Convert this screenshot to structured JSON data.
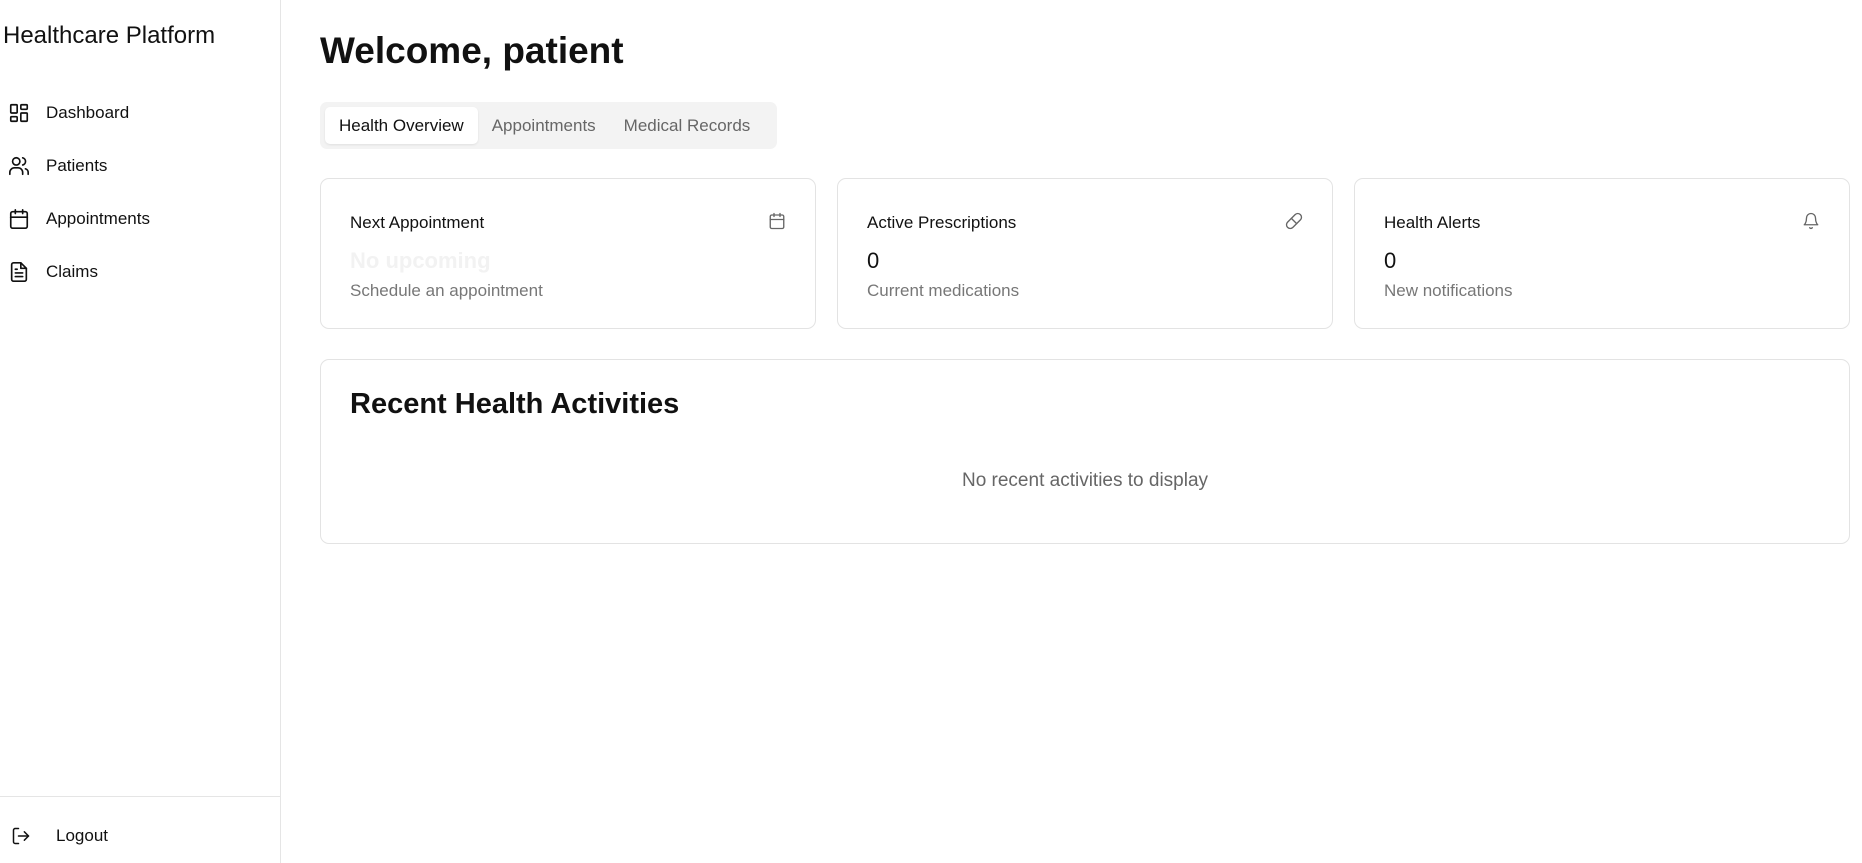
{
  "app": {
    "brand": "Healthcare Platform"
  },
  "sidebar": {
    "items": [
      {
        "label": "Dashboard",
        "icon": "dashboard-icon"
      },
      {
        "label": "Patients",
        "icon": "users-icon"
      },
      {
        "label": "Appointments",
        "icon": "calendar-icon"
      },
      {
        "label": "Claims",
        "icon": "document-icon"
      }
    ],
    "logout_label": "Logout"
  },
  "header": {
    "title": "Welcome, patient"
  },
  "tabs": [
    {
      "label": "Health Overview",
      "active": true
    },
    {
      "label": "Appointments",
      "active": false
    },
    {
      "label": "Medical Records",
      "active": false
    }
  ],
  "cards": [
    {
      "title": "Next Appointment",
      "icon": "calendar-icon",
      "value": "No upcoming",
      "subtitle": "Schedule an appointment"
    },
    {
      "title": "Active Prescriptions",
      "icon": "pill-icon",
      "value": "0",
      "subtitle": "Current medications"
    },
    {
      "title": "Health Alerts",
      "icon": "bell-icon",
      "value": "0",
      "subtitle": "New notifications"
    }
  ],
  "activity": {
    "title": "Recent Health Activities",
    "empty_text": "No recent activities to display"
  },
  "colors": {
    "border": "#e3e3e3",
    "tab_bg": "#f3f3f3",
    "muted_text": "#777777",
    "text": "#111111"
  }
}
